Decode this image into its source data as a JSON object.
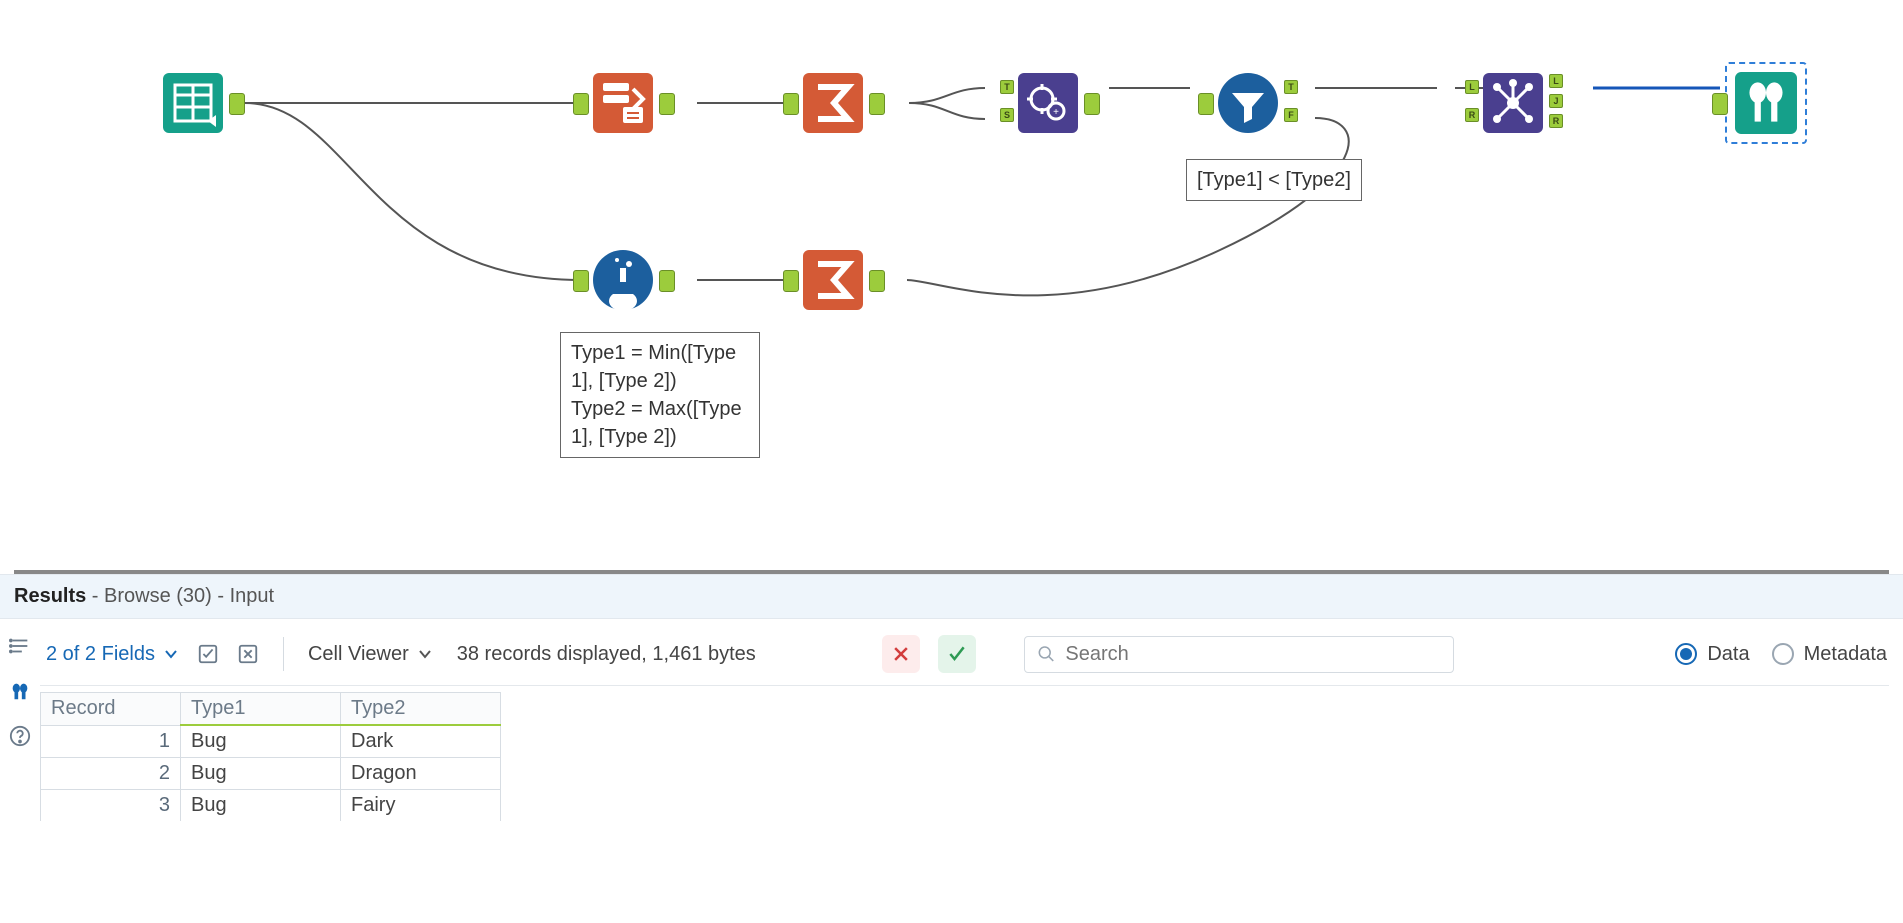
{
  "annotations": {
    "formula": "Type1 = Min([Type 1], [Type 2])\nType2 = Max([Type 1], [Type 2])",
    "filter": "[Type1] < [Type2]"
  },
  "results": {
    "title_strong": "Results",
    "title_rest": " - Browse (30) - Input",
    "fields_label": "2 of 2 Fields",
    "cell_viewer_label": "Cell Viewer",
    "status": "38 records displayed, 1,461 bytes",
    "search_placeholder": "Search",
    "radio_data": "Data",
    "radio_metadata": "Metadata",
    "columns": [
      "Record",
      "Type1",
      "Type2"
    ],
    "rows": [
      {
        "record": "1",
        "type1": "Bug",
        "type2": "Dark"
      },
      {
        "record": "2",
        "type1": "Bug",
        "type2": "Dragon"
      },
      {
        "record": "3",
        "type1": "Bug",
        "type2": "Fairy"
      }
    ]
  }
}
